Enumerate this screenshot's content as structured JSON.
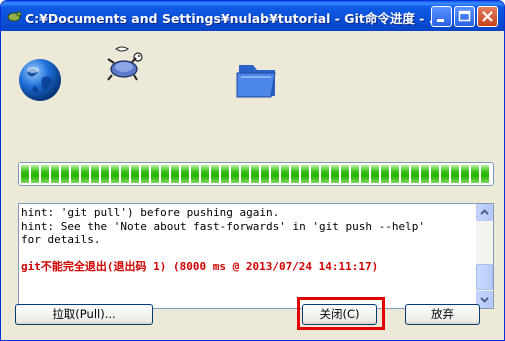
{
  "window": {
    "title": "C:¥Documents and Settings¥nulab¥tutorial - Git命令进度 - ..."
  },
  "icons": {
    "network": "globe-icon",
    "transfer": "turtle-icon",
    "destination": "folder-icon"
  },
  "progress": {
    "value_percent": 100
  },
  "log": {
    "lines": [
      "hint: 'git pull') before pushing again.",
      "hint: See the 'Note about fast-forwards' in 'git push --help'",
      "for details."
    ],
    "error_line": "git不能完全退出(退出码 1) (8000 ms @ 2013/07/24 14:11:17)"
  },
  "buttons": {
    "pull": "拉取(Pull)...",
    "close": "关闭(C)",
    "abort": "放弃"
  },
  "colors": {
    "titlebar": "#0a4fd8",
    "progress": "#27b300",
    "error_text": "#d00000",
    "highlight": "#e00000"
  }
}
